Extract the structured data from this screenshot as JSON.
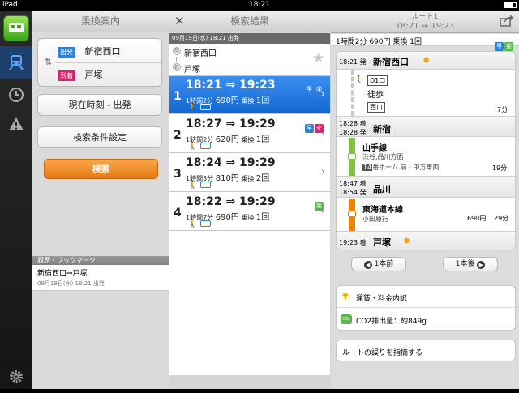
{
  "status": {
    "device": "iPad",
    "time": "18:21"
  },
  "panel1": {
    "title": "乗換案内",
    "from_tag": "出発",
    "from_name": "新宿西口",
    "to_tag": "到着",
    "to_name": "戸塚",
    "now_button": "現在時刻 - 出発",
    "settings_button": "検索条件設定",
    "search_button": "検索",
    "history_header": "履歴・ブックマーク",
    "history_route": "新宿西口⇒戸塚",
    "history_time": "09月19日(水) 18:21 出発"
  },
  "panel2": {
    "title": "検索結果",
    "close": "✕",
    "date_line": "09月19日(水) 18:21 出発",
    "from": "新宿西口",
    "to": "戸塚",
    "from_mark": "発",
    "to_mark": "着",
    "results": [
      {
        "num": "1",
        "times": "18:21 ⇒ 19:23",
        "dur_a": "1時間2分",
        "price": "690円",
        "xfer_label": "乗換",
        "xfer": "1回",
        "badges": [
          "早",
          "楽"
        ],
        "selected": true
      },
      {
        "num": "2",
        "times": "18:27 ⇒ 19:29",
        "dur_a": "1時間2分",
        "price": "620円",
        "xfer_label": "乗換",
        "xfer": "1回",
        "badges": [
          "早",
          "安"
        ],
        "selected": false
      },
      {
        "num": "3",
        "times": "18:24 ⇒ 19:29",
        "dur_a": "1時間5分",
        "price": "810円",
        "xfer_label": "乗換",
        "xfer": "2回",
        "badges": [],
        "selected": false
      },
      {
        "num": "4",
        "times": "18:22 ⇒ 19:29",
        "dur_a": "1時間7分",
        "price": "690円",
        "xfer_label": "乗換",
        "xfer": "1回",
        "badges": [
          "楽"
        ],
        "selected": false
      }
    ]
  },
  "panel3": {
    "title": "ルート1",
    "subtitle": "18:21 ⇒ 19:23",
    "summary": "1時間2分 690円 乗換 1回",
    "summary_badges": [
      "早",
      "楽"
    ],
    "steps": {
      "s1_time": "18:21",
      "s1_mark": "発",
      "s1_name": "新宿西口",
      "exit1": "D1口",
      "walk": "徒歩",
      "exit2": "西口",
      "walk_min": "7分",
      "s2_arr": "18:28",
      "s2_arr_mark": "着",
      "s2_dep": "18:28",
      "s2_dep_mark": "発",
      "s2_name": "新宿",
      "line1": "山手線",
      "line1_dir": "渋谷,品川方面",
      "line1_track_num": "14",
      "line1_track": "番ホーム 前・中方車両",
      "line1_min": "19分",
      "s3_arr": "18:47",
      "s3_arr_mark": "着",
      "s3_dep": "18:54",
      "s3_dep_mark": "発",
      "s3_name": "品川",
      "line2": "東海道本線",
      "line2_dir": "小田原行",
      "line2_price": "690円",
      "line2_min": "29分",
      "s4_time": "19:23",
      "s4_mark": "着",
      "s4_name": "戸塚"
    },
    "prev_button": "1本前",
    "next_button": "1本後",
    "fare_label": "運賃・料金内訳",
    "co2_label": "CO2排出量：約849g",
    "co2_icon": "CO₂",
    "report_label": "ルートの誤りを指摘する"
  },
  "colors": {
    "accent_blue": "#1e79e0",
    "green_line": "#80c241",
    "orange_line": "#f08300",
    "search_orange": "#f08a24"
  }
}
